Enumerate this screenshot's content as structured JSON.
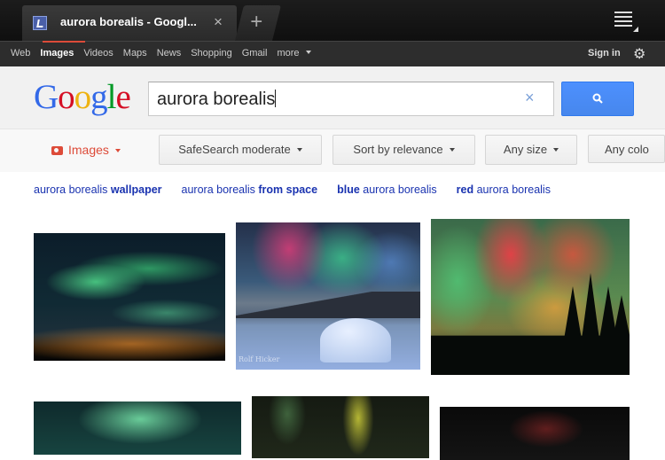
{
  "browser": {
    "tab_title": "aurora borealis - Googl...",
    "close_glyph": "×",
    "newtab_glyph": "+"
  },
  "gbar": {
    "nav": [
      "Web",
      "Images",
      "Videos",
      "Maps",
      "News",
      "Shopping",
      "Gmail",
      "more"
    ],
    "active": "Images",
    "sign_in": "Sign in"
  },
  "search": {
    "logo_letters": [
      "G",
      "o",
      "o",
      "g",
      "l",
      "e"
    ],
    "query": "aurora borealis",
    "clear_glyph": "×"
  },
  "tools": {
    "images_label": "Images",
    "safesearch": "SafeSearch moderate",
    "sort": "Sort by relevance",
    "size": "Any size",
    "color": "Any colo"
  },
  "related": [
    {
      "base": "aurora borealis",
      "suffix": " wallpaper"
    },
    {
      "base": "aurora borealis",
      "suffix": " from space"
    },
    {
      "prefix": "blue",
      "base": " aurora borealis"
    },
    {
      "prefix": "red",
      "base": " aurora borealis"
    }
  ],
  "thumbs": {
    "t2_watermark": "Rolf Hicker"
  },
  "colors": {
    "accent_red": "#dd4b39",
    "search_button": "#4d90fe",
    "link_blue": "#1a33b0"
  }
}
